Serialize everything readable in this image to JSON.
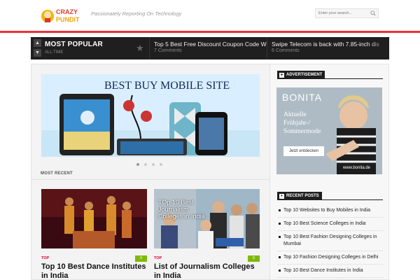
{
  "header": {
    "logo_line1": "CRAZY",
    "logo_line2": "PUNDIT",
    "tagline": "Passionately Reporting On Technology",
    "search_placeholder": "Enter your search..."
  },
  "popular": {
    "title": "MOST POPULAR",
    "subtitle": "ALL TIME",
    "items": [
      {
        "title": "Top 5 Best Free Discount Coupon Code W",
        "comments": "7 Comments"
      },
      {
        "title": "Swipe Telecom is back with 7.85-inch dis",
        "comments": "6 Comments"
      }
    ]
  },
  "slider": {
    "title": "BEST BUY MOBILE SITE"
  },
  "main": {
    "recent_label": "MOST RECENT",
    "cards": [
      {
        "category": "TOP",
        "count": "0",
        "title": "Top 10 Best Dance Institutes in India"
      },
      {
        "category": "TOP",
        "count": "0",
        "title": "List of Journalism Colleges in India",
        "image_text": "TOp 10 Best Journalism Colleges in India"
      }
    ]
  },
  "sidebar": {
    "ad_title": "ADVERTISEMENT",
    "ad": {
      "brand": "BONITA",
      "line1": "Aktuelle",
      "line2": "Frühjahr-/",
      "line3": "Sommermode",
      "button": "Jetzt entdecken",
      "url": "www.bonita.de"
    },
    "recent_title": "RECENT POSTS",
    "recent_posts": [
      "Top 10 Websites to Buy Mobiles in India",
      "Top 10 Best Science Colleges in India",
      "Top 10 Best Fashion Designing Colleges in Mumbai",
      "Top 10 Fashion Designing Colleges in Delhi",
      "Top 10 Best Dance Institutes in India"
    ]
  },
  "colors": {
    "accent": "#e8313f",
    "dark": "#1f1f1f",
    "count_badge": "#7fba00"
  }
}
